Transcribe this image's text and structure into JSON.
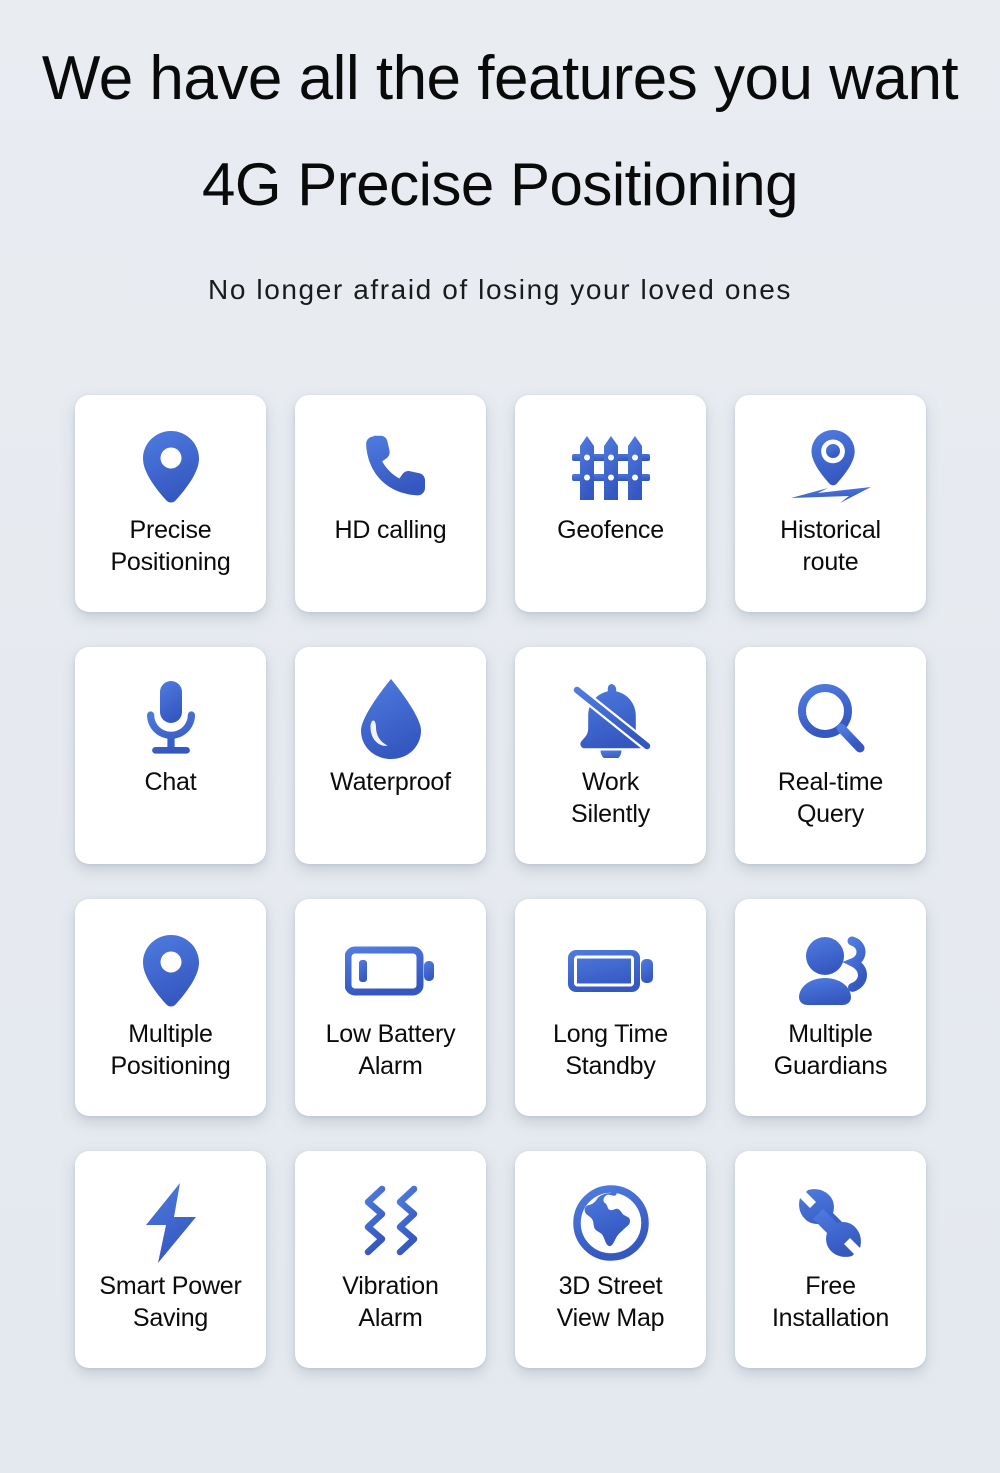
{
  "header": {
    "title_line_1": "We have all the features you want",
    "title_line_2": "4G Precise Positioning",
    "subtitle": "No longer afraid of losing your loved ones"
  },
  "theme": {
    "background": "#e8ecf1",
    "card_background": "#ffffff",
    "icon_blue": "#4169d4",
    "icon_blue_dark": "#3558c0",
    "text_color": "#0b0b0b"
  },
  "features": [
    {
      "label": "Precise\nPositioning",
      "icon": "map-pin-icon"
    },
    {
      "label": "HD calling",
      "icon": "phone-icon"
    },
    {
      "label": "Geofence",
      "icon": "fence-icon"
    },
    {
      "label": "Historical\nroute",
      "icon": "route-pin-icon"
    },
    {
      "label": "Chat",
      "icon": "microphone-icon"
    },
    {
      "label": "Waterproof",
      "icon": "water-drop-icon"
    },
    {
      "label": "Work\nSilently",
      "icon": "bell-off-icon"
    },
    {
      "label": "Real-time\nQuery",
      "icon": "search-icon"
    },
    {
      "label": "Multiple\nPositioning",
      "icon": "map-pin-icon"
    },
    {
      "label": "Low Battery\nAlarm",
      "icon": "battery-low-icon"
    },
    {
      "label": "Long Time\nStandby",
      "icon": "battery-full-icon"
    },
    {
      "label": "Multiple\nGuardians",
      "icon": "users-icon"
    },
    {
      "label": "Smart Power\nSaving",
      "icon": "lightning-bolt-icon"
    },
    {
      "label": "Vibration\nAlarm",
      "icon": "vibration-icon"
    },
    {
      "label": "3D Street\nView Map",
      "icon": "globe-icon"
    },
    {
      "label": "Free\nInstallation",
      "icon": "wrench-icon"
    }
  ]
}
